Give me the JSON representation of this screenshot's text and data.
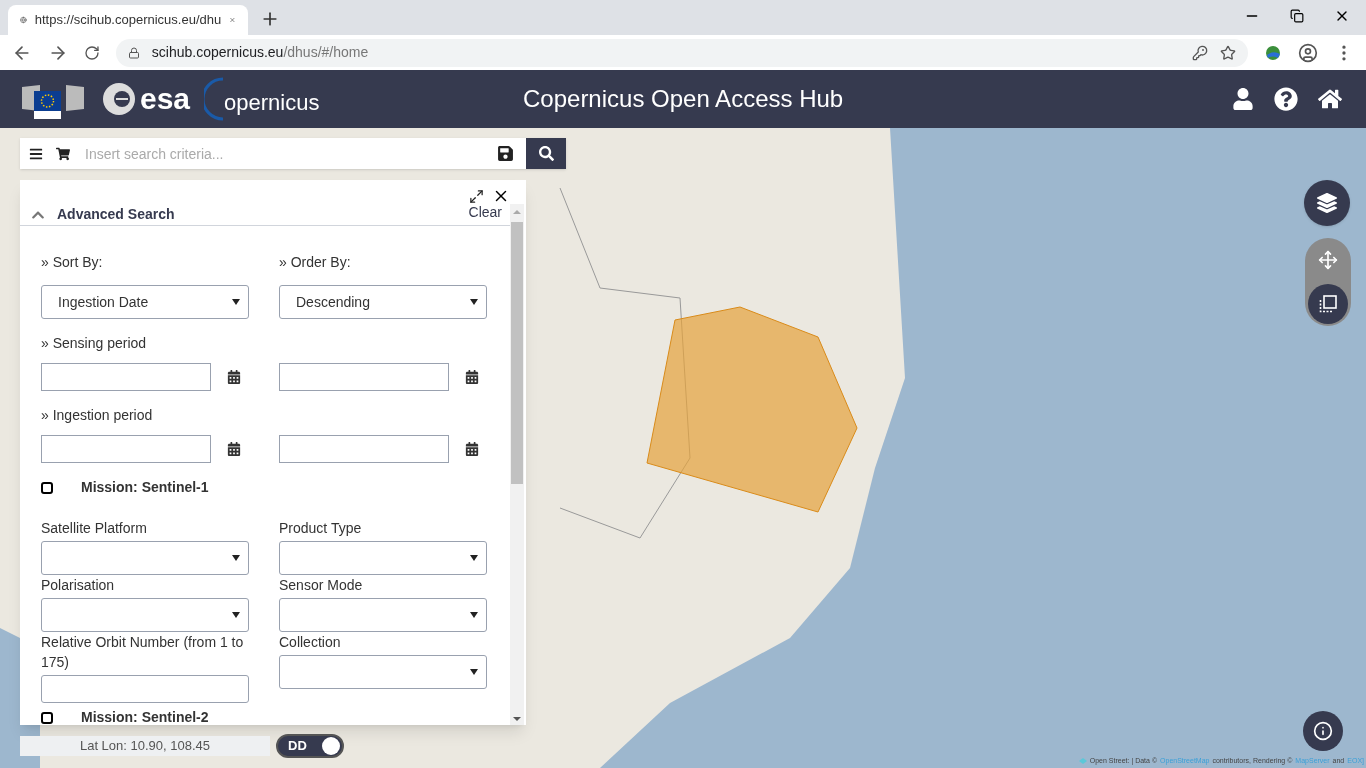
{
  "browser": {
    "tab_title": "https://scihub.copernicus.eu/dhu",
    "url_host": "scihub.copernicus.eu",
    "url_path": "/dhus/#/home"
  },
  "header": {
    "esa_logo": "esa",
    "copernicus_logo": "opernicus",
    "title": "Copernicus Open Access Hub"
  },
  "search": {
    "placeholder": "Insert search criteria..."
  },
  "advanced_search": {
    "title": "Advanced Search",
    "clear": "Clear",
    "sort_by": {
      "label": "» Sort By:",
      "value": "Ingestion Date"
    },
    "order_by": {
      "label": "» Order By:",
      "value": "Descending"
    },
    "periods": [
      {
        "label": "» Sensing period"
      },
      {
        "label": "» Ingestion period"
      }
    ],
    "missions": [
      {
        "label": "Mission: Sentinel-1",
        "checked": false,
        "fields": [
          {
            "label": "Satellite Platform",
            "kind": "select"
          },
          {
            "label": "Product Type",
            "kind": "select"
          },
          {
            "label": "Polarisation",
            "kind": "select"
          },
          {
            "label": "Sensor Mode",
            "kind": "select"
          },
          {
            "label": "Relative Orbit Number (from 1 to 175)",
            "kind": "input"
          },
          {
            "label": "Collection",
            "kind": "select"
          }
        ]
      },
      {
        "label": "Mission: Sentinel-2",
        "checked": false
      }
    ]
  },
  "coordinates": {
    "text": "Lat Lon: 10.90, 108.45"
  },
  "format_toggle": {
    "label": "DD",
    "on": true
  },
  "attribution": [
    {
      "text": "Open Street: | Data ©",
      "link": false
    },
    {
      "text": "OpenStreetMap",
      "link": true
    },
    {
      "text": "contributors, Rendering ©",
      "link": false
    },
    {
      "text": "MapServer",
      "link": true
    },
    {
      "text": "and",
      "link": false
    },
    {
      "text": "EOX]",
      "link": true
    }
  ]
}
